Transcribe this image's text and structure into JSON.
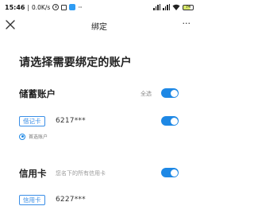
{
  "status_bar": {
    "time": "15:46",
    "speed": "0.0K/s",
    "battery": "74"
  },
  "title_bar": {
    "title": "绑定",
    "more": "···"
  },
  "heading": "请选择需要绑定的账户",
  "savings": {
    "title": "储蓄账户",
    "select_all": "全选",
    "card_type": "借记卡",
    "card_number": "6217***",
    "default_label": "首选账户"
  },
  "credit": {
    "title": "信用卡",
    "hint": "您名下的所有信用卡",
    "card_type": "信用卡",
    "card_number": "6227***"
  },
  "colors": {
    "accent": "#1e88e5",
    "tag_border": "#3a8ee6"
  },
  "icons": {
    "close": "close-icon",
    "more": "more-icon"
  }
}
